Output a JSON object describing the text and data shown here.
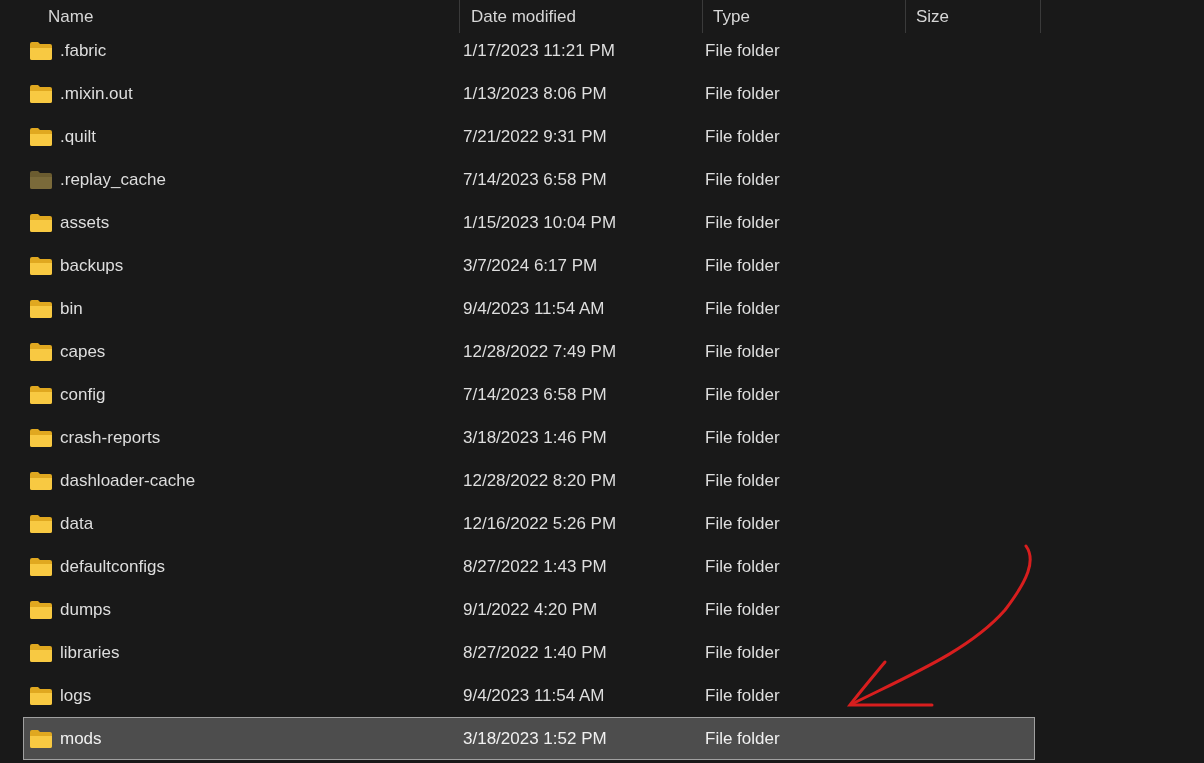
{
  "columns": [
    "Name",
    "Date modified",
    "Type",
    "Size"
  ],
  "rows": [
    {
      "name": ".fabric",
      "date": "1/17/2023 11:21 PM",
      "type": "File folder",
      "hidden": false,
      "selected": false
    },
    {
      "name": ".mixin.out",
      "date": "1/13/2023 8:06 PM",
      "type": "File folder",
      "hidden": false,
      "selected": false
    },
    {
      "name": ".quilt",
      "date": "7/21/2022 9:31 PM",
      "type": "File folder",
      "hidden": false,
      "selected": false
    },
    {
      "name": ".replay_cache",
      "date": "7/14/2023 6:58 PM",
      "type": "File folder",
      "hidden": true,
      "selected": false
    },
    {
      "name": "assets",
      "date": "1/15/2023 10:04 PM",
      "type": "File folder",
      "hidden": false,
      "selected": false
    },
    {
      "name": "backups",
      "date": "3/7/2024 6:17 PM",
      "type": "File folder",
      "hidden": false,
      "selected": false
    },
    {
      "name": "bin",
      "date": "9/4/2023 11:54 AM",
      "type": "File folder",
      "hidden": false,
      "selected": false
    },
    {
      "name": "capes",
      "date": "12/28/2022 7:49 PM",
      "type": "File folder",
      "hidden": false,
      "selected": false
    },
    {
      "name": "config",
      "date": "7/14/2023 6:58 PM",
      "type": "File folder",
      "hidden": false,
      "selected": false
    },
    {
      "name": "crash-reports",
      "date": "3/18/2023 1:46 PM",
      "type": "File folder",
      "hidden": false,
      "selected": false
    },
    {
      "name": "dashloader-cache",
      "date": "12/28/2022 8:20 PM",
      "type": "File folder",
      "hidden": false,
      "selected": false
    },
    {
      "name": "data",
      "date": "12/16/2022 5:26 PM",
      "type": "File folder",
      "hidden": false,
      "selected": false
    },
    {
      "name": "defaultconfigs",
      "date": "8/27/2022 1:43 PM",
      "type": "File folder",
      "hidden": false,
      "selected": false
    },
    {
      "name": "dumps",
      "date": "9/1/2022 4:20 PM",
      "type": "File folder",
      "hidden": false,
      "selected": false
    },
    {
      "name": "libraries",
      "date": "8/27/2022 1:40 PM",
      "type": "File folder",
      "hidden": false,
      "selected": false
    },
    {
      "name": "logs",
      "date": "9/4/2023 11:54 AM",
      "type": "File folder",
      "hidden": false,
      "selected": false
    },
    {
      "name": "mods",
      "date": "3/18/2023 1:52 PM",
      "type": "File folder",
      "hidden": false,
      "selected": true
    }
  ]
}
